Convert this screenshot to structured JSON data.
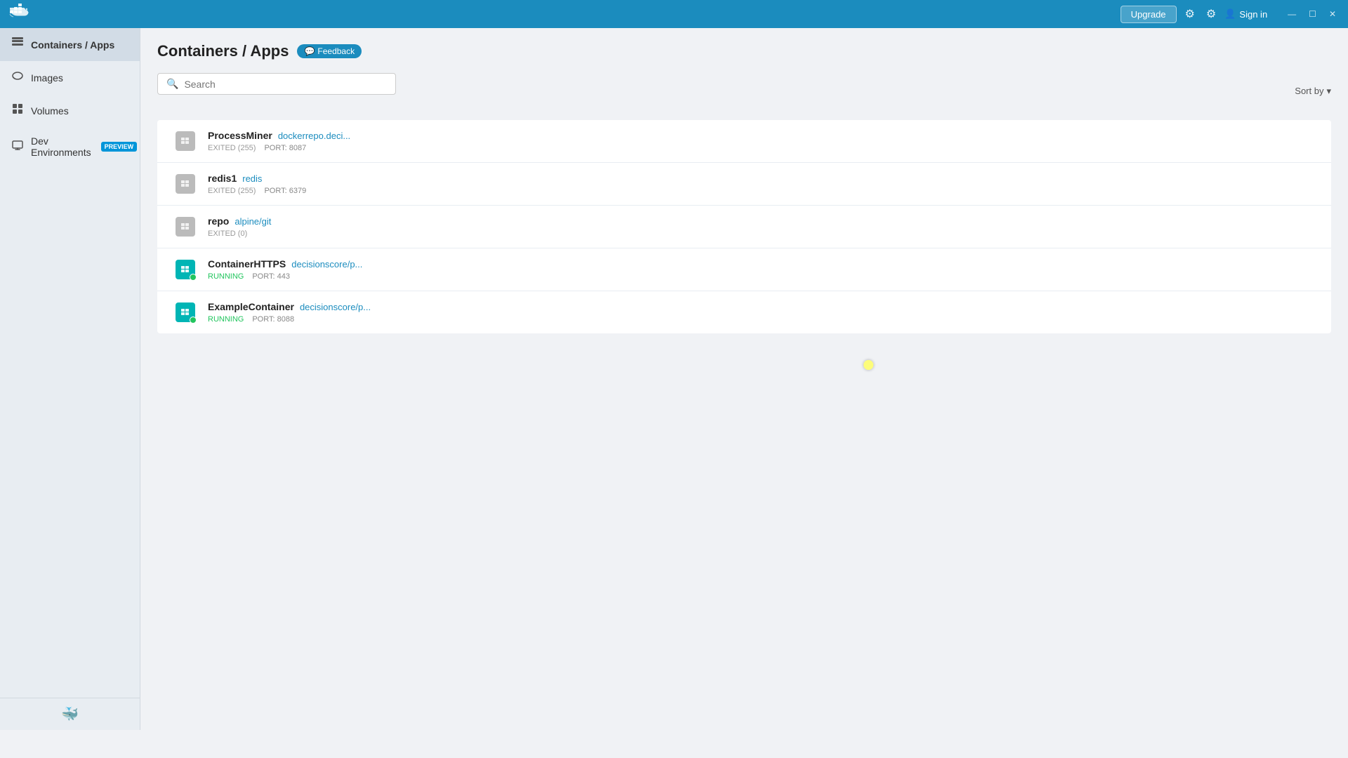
{
  "titlebar": {
    "logo_alt": "Docker",
    "upgrade_label": "Upgrade",
    "settings_icon": "⚙",
    "account_icon": "◯",
    "signin_label": "Sign in",
    "window_minimize": "—",
    "window_maximize": "☐",
    "window_close": "✕"
  },
  "sidebar": {
    "items": [
      {
        "id": "containers",
        "label": "Containers / Apps",
        "icon": "▦",
        "active": true,
        "badge": null
      },
      {
        "id": "images",
        "label": "Images",
        "icon": "☁",
        "active": false,
        "badge": null
      },
      {
        "id": "volumes",
        "label": "Volumes",
        "icon": "⊞",
        "active": false,
        "badge": null
      },
      {
        "id": "dev-environments",
        "label": "Dev Environments",
        "icon": "⊡",
        "active": false,
        "badge": "PREVIEW"
      }
    ],
    "bottom_icon": "🐳"
  },
  "page": {
    "title": "Containers / Apps",
    "feedback_label": "Feedback",
    "search_placeholder": "Search",
    "sort_label": "Sort by",
    "sort_icon": "▾"
  },
  "containers": [
    {
      "name": "ProcessMiner",
      "image": "dockerrepo.deci...",
      "status": "stopped",
      "status_text": "EXITED (255)",
      "port": "PORT: 8087",
      "running": false
    },
    {
      "name": "redis1",
      "image": "redis",
      "status": "stopped",
      "status_text": "EXITED (255)",
      "port": "PORT: 6379",
      "running": false
    },
    {
      "name": "repo",
      "image": "alpine/git",
      "status": "stopped",
      "status_text": "EXITED (0)",
      "port": null,
      "running": false
    },
    {
      "name": "ContainerHTTPS",
      "image": "decisionscore/p...",
      "status": "running",
      "status_text": "RUNNING",
      "port": "PORT: 443",
      "running": true
    },
    {
      "name": "ExampleContainer",
      "image": "decisionscore/p...",
      "status": "running",
      "status_text": "RUNNING",
      "port": "PORT: 8088",
      "running": true
    }
  ],
  "colors": {
    "titlebar_bg": "#1b8cbe",
    "sidebar_bg": "#e8edf2",
    "active_nav": "#d2dce6",
    "running_icon": "#00b5b5",
    "stopped_icon": "#bbb",
    "accent_blue": "#1b8cbe",
    "running_green": "#22c55e"
  }
}
